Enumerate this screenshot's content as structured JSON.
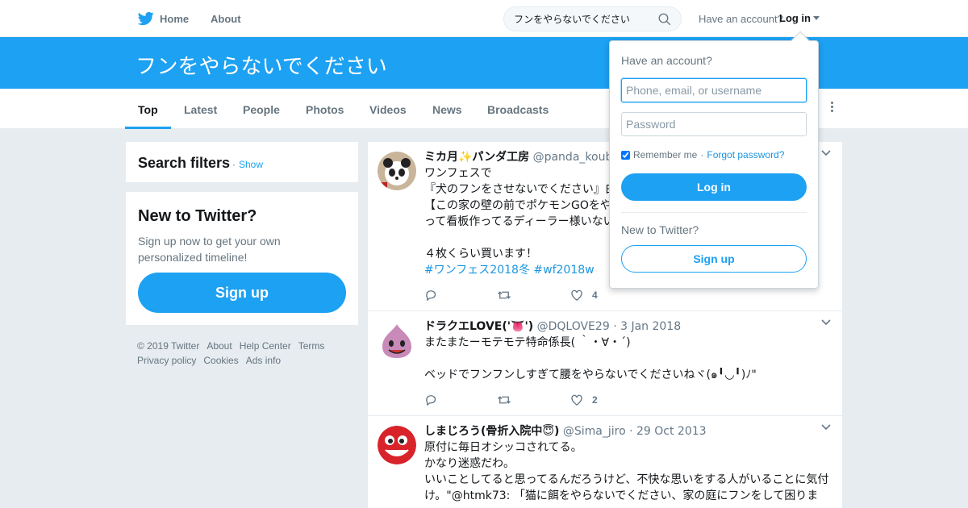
{
  "colors": {
    "brand": "#1da1f2",
    "link": "#1b95e0",
    "muted": "#66757f",
    "background": "#e6ecf0"
  },
  "nav": {
    "logo_icon": "twitter-bird-icon",
    "home_label": "Home",
    "about_label": "About",
    "search_value": "フンをやらないでください",
    "search_icon": "search-icon",
    "have_account_label": "Have an account?",
    "login_label": "Log in"
  },
  "banner": {
    "title": "フンをやらないでください"
  },
  "tabs": [
    {
      "label": "Top",
      "active": true
    },
    {
      "label": "Latest"
    },
    {
      "label": "People"
    },
    {
      "label": "Photos"
    },
    {
      "label": "Videos"
    },
    {
      "label": "News"
    },
    {
      "label": "Broadcasts"
    }
  ],
  "sidebar": {
    "filters_title": "Search filters",
    "filters_separator": "·",
    "filters_show": "Show",
    "new_title": "New to Twitter?",
    "new_text": "Sign up now to get your own personalized timeline!",
    "signup_label": "Sign up",
    "footer": [
      "© 2019 Twitter",
      "About",
      "Help Center",
      "Terms",
      "Privacy policy",
      "Cookies",
      "Ads info"
    ]
  },
  "tweets": [
    {
      "name": "ミカ月✨パンダ工房",
      "handle": "@panda_koubo",
      "lines": [
        "ワンフェスで",
        "『犬のフンをさせないでください』白",
        "【この家の壁の前でポケモンGOをや",
        "って看板作ってるディーラー様いない",
        "",
        "４枚くらい買います！"
      ],
      "hashtags": "#ワンフェス2018冬 #wf2018w",
      "likes": "4"
    },
    {
      "name": "ドラクエLOVE('👅')",
      "handle": "@DQLOVE29",
      "date": "3 Jan 2018",
      "lines": [
        "またまたーモテモテ特命係長( ｀・∀・´)",
        "",
        "ベッドでフンフンしすぎて腰をやらないでくださいねヾ(๑╹◡╹)ﾉ\""
      ],
      "likes": "2"
    },
    {
      "name": "しまじろう(骨折入院中😇)",
      "handle": "@Sima_jiro",
      "date": "29 Oct 2013",
      "lines": [
        "原付に毎日オシッコされてる。",
        "かなり迷惑だわ。",
        "いいことしてると思ってるんだろうけど、不快な思いをする人がいることに気付",
        "け。\"@htmk73: 「猫に餌をやらないでください、家の庭にフンをして困りま"
      ]
    }
  ],
  "login_dropdown": {
    "title": "Have an account?",
    "username_placeholder": "Phone, email, or username",
    "password_placeholder": "Password",
    "remember_label": "Remember me",
    "remember_checked": true,
    "separator": "·",
    "forgot_label": "Forgot password?",
    "login_button": "Log in",
    "new_label": "New to Twitter?",
    "signup_button": "Sign up"
  }
}
